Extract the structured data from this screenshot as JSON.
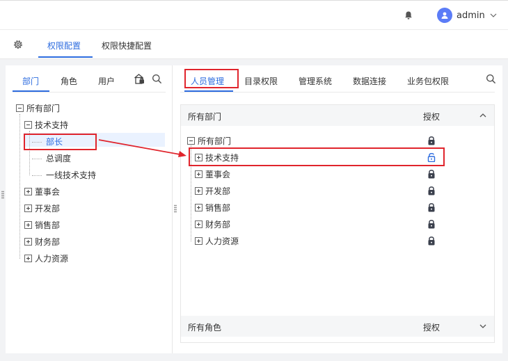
{
  "header": {
    "username": "admin",
    "icons": [
      "bell-icon",
      "chevron-down-icon",
      "gear-icon"
    ]
  },
  "subnav": {
    "tabs": [
      "权限配置",
      "权限快捷配置"
    ],
    "active": 0
  },
  "left": {
    "tabs": [
      "部门",
      "角色",
      "用户"
    ],
    "active": 0,
    "tree": {
      "root": "所有部门",
      "tech": "技术支持",
      "tech_children": [
        "部长",
        "总调度",
        "一线技术支持"
      ],
      "others": [
        "董事会",
        "开发部",
        "销售部",
        "财务部",
        "人力资源"
      ],
      "selected": "部长"
    }
  },
  "right": {
    "tabs": [
      "人员管理",
      "目录权限",
      "管理系统",
      "数据连接",
      "业务包权限"
    ],
    "active": 0,
    "dept_panel": {
      "title": "所有部门",
      "auth_label": "授权",
      "root": "所有部门",
      "items": [
        "技术支持",
        "董事会",
        "开发部",
        "销售部",
        "财务部",
        "人力资源"
      ],
      "unlocked_item": "技术支持"
    },
    "role_panel": {
      "title": "所有角色",
      "auth_label": "授权"
    }
  },
  "colors": {
    "accent": "#2d6cdf",
    "highlight_box": "#e0242c",
    "lock": "#3a3f4c",
    "unlock": "#2d6cdf"
  }
}
